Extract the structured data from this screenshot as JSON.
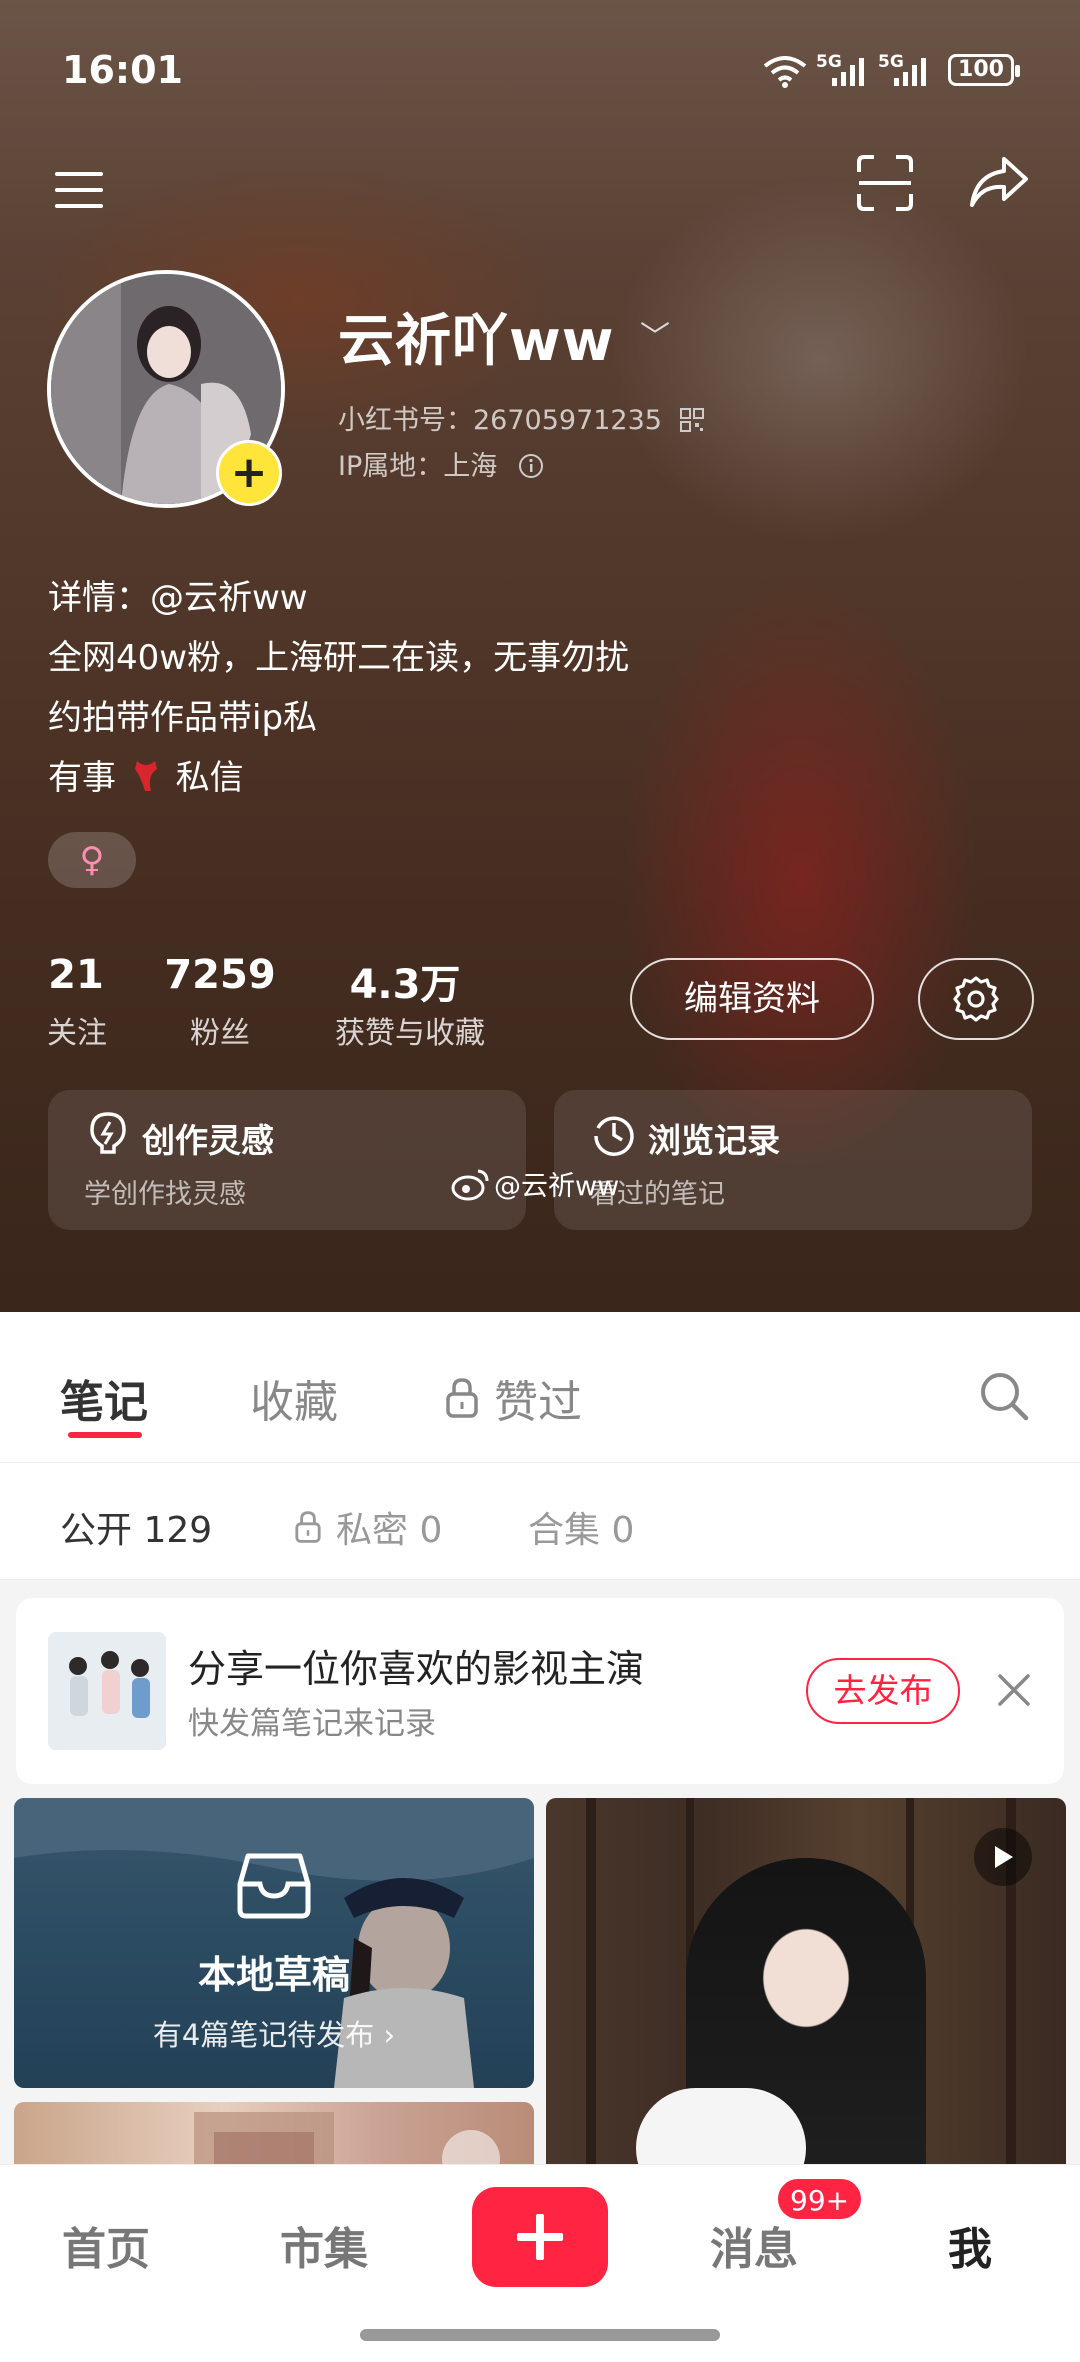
{
  "status": {
    "time": "16:01",
    "sig1": "5G",
    "sig2": "5G",
    "battery": "100"
  },
  "profile": {
    "name": "云祈吖ww",
    "id_line": "小红书号：26705971235",
    "ip_line": "IP属地：上海",
    "bio": [
      "详情：@云祈ww",
      "全网40w粉，上海研二在读，无事勿扰",
      "约拍带作品带ip私",
      "有事",
      "私信"
    ],
    "gender_symbol": "♀"
  },
  "stats": [
    {
      "num": "21",
      "label": "关注"
    },
    {
      "num": "7259",
      "label": "粉丝"
    },
    {
      "num": "4.3万",
      "label": "获赞与收藏"
    }
  ],
  "actions": {
    "edit": "编辑资料"
  },
  "cards": [
    {
      "title": "创作灵感",
      "sub": "学创作找灵感"
    },
    {
      "title": "浏览记录",
      "sub": "看过的笔记"
    }
  ],
  "watermark": "@云祈ww",
  "tabs": [
    "笔记",
    "收藏",
    "赞过"
  ],
  "subtabs": [
    "公开 129",
    "私密 0",
    "合集 0"
  ],
  "share": {
    "title": "分享一位你喜欢的影视主演",
    "sub": "快发篇笔记来记录",
    "button": "去发布"
  },
  "draft": {
    "title": "本地草稿",
    "sub": "有4篇笔记待发布"
  },
  "nav": {
    "home": "首页",
    "market": "市集",
    "messages": "消息",
    "me": "我",
    "badge": "99+"
  },
  "colors": {
    "accent": "#ff2442",
    "yellow": "#ffe53a"
  }
}
